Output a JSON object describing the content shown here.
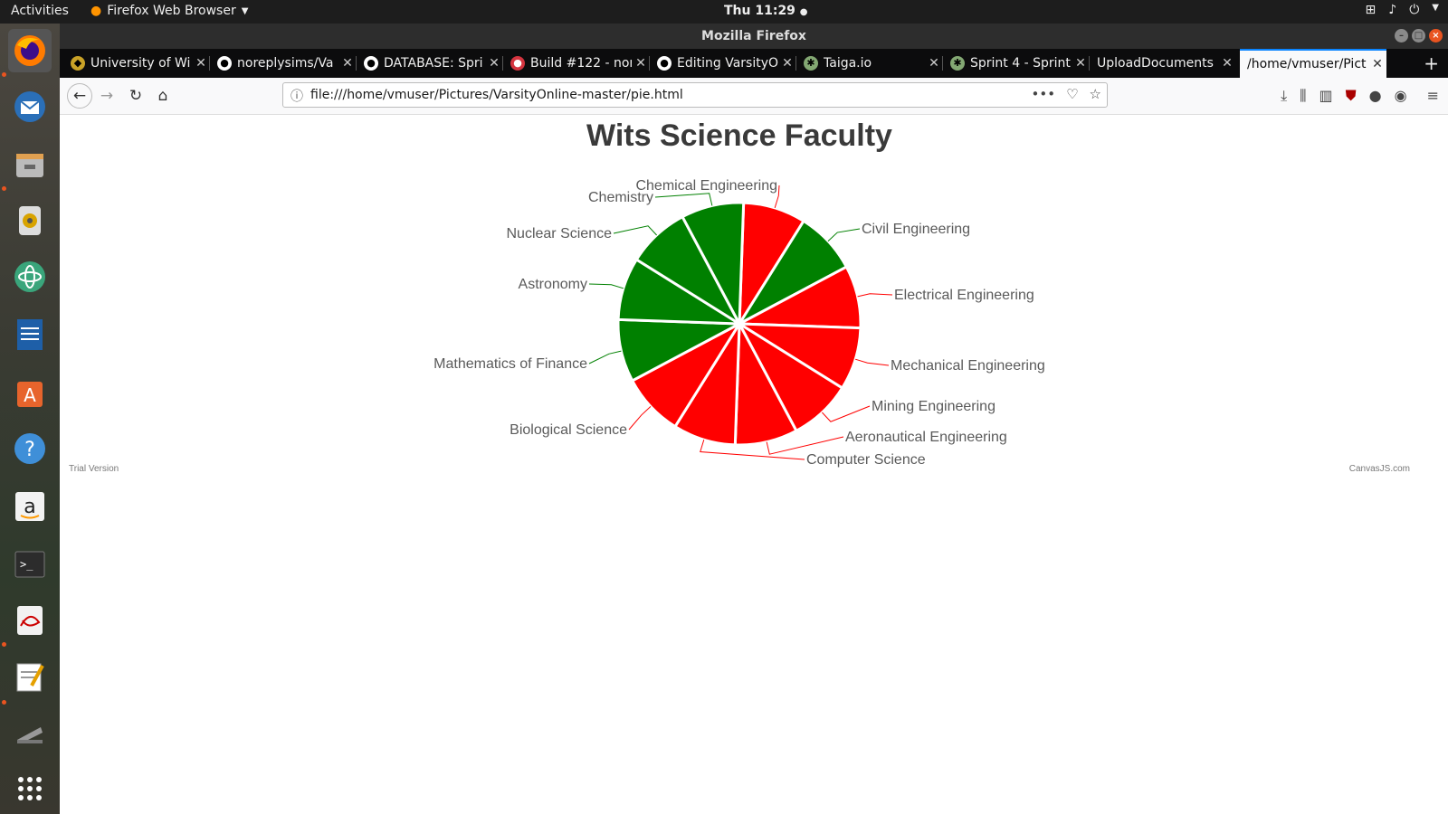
{
  "topbar": {
    "activities": "Activities",
    "app_menu": "Firefox Web Browser",
    "clock": "Thu 11:29"
  },
  "dock": {
    "items": [
      "firefox-icon",
      "thunderbird-icon",
      "files-icon",
      "rhythmbox-icon",
      "atom-icon",
      "writer-icon",
      "software-icon",
      "help-icon",
      "amazon-icon",
      "terminal-icon",
      "pdf-viewer-icon",
      "text-editor-icon",
      "scanner-icon",
      "app-grid-icon"
    ]
  },
  "window": {
    "title": "Mozilla Firefox"
  },
  "tabs": [
    {
      "label": "University of Wi",
      "icon": "wits-icon"
    },
    {
      "label": "noreplysims/Va",
      "icon": "github-icon"
    },
    {
      "label": "DATABASE: Spri",
      "icon": "github-icon"
    },
    {
      "label": "Build #122 - nor",
      "icon": "travis-icon"
    },
    {
      "label": "Editing VarsityO",
      "icon": "github-icon"
    },
    {
      "label": "Taiga.io",
      "icon": "taiga-icon"
    },
    {
      "label": "Sprint 4 - Sprint",
      "icon": "taiga-icon"
    },
    {
      "label": "UploadDocuments",
      "icon": "none"
    },
    {
      "label": "/home/vmuser/Pict",
      "icon": "none",
      "active": true
    }
  ],
  "navbar": {
    "url": "file:///home/vmuser/Pictures/VarsityOnline-master/pie.html"
  },
  "page": {
    "trial": "Trial Version",
    "credit": "CanvasJS.com"
  },
  "colors": {
    "green": "#008000",
    "red": "#ff0000",
    "label": "#5a5a5a",
    "title": "#3a3a3a"
  },
  "chart_data": {
    "type": "pie",
    "title": "Wits Science Faculty",
    "slices": [
      {
        "label": "Chemical Engineering",
        "value": 1,
        "color": "#ff0000"
      },
      {
        "label": "Civil Engineering",
        "value": 1,
        "color": "#008000"
      },
      {
        "label": "Electrical Engineering",
        "value": 1,
        "color": "#ff0000"
      },
      {
        "label": "Mechanical Engineering",
        "value": 1,
        "color": "#ff0000"
      },
      {
        "label": "Mining Engineering",
        "value": 1,
        "color": "#ff0000"
      },
      {
        "label": "Aeronautical Engineering",
        "value": 1,
        "color": "#ff0000"
      },
      {
        "label": "Computer Science",
        "value": 1,
        "color": "#ff0000"
      },
      {
        "label": "Biological Science",
        "value": 1,
        "color": "#ff0000"
      },
      {
        "label": "Mathematics of Finance",
        "value": 1,
        "color": "#008000"
      },
      {
        "label": "Astronomy",
        "value": 1,
        "color": "#008000"
      },
      {
        "label": "Nuclear Science",
        "value": 1,
        "color": "#008000"
      },
      {
        "label": "Chemistry",
        "value": 1,
        "color": "#008000"
      }
    ]
  }
}
